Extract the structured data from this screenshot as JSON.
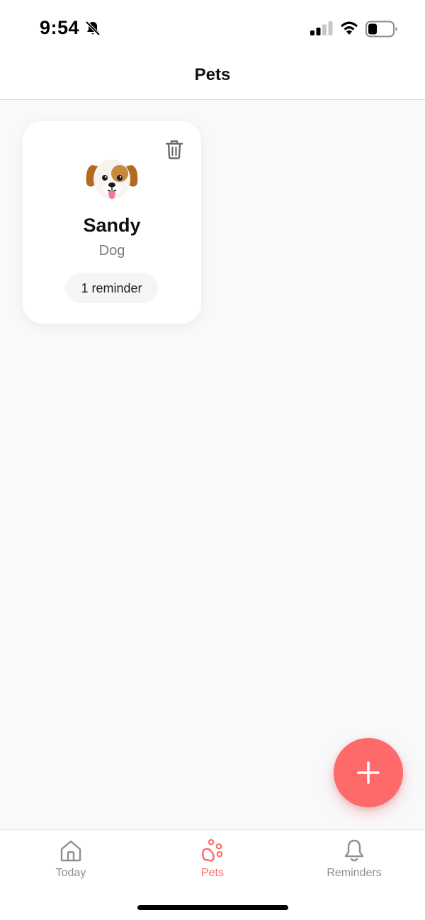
{
  "status_bar": {
    "time": "9:54",
    "icons": [
      "bell-off-icon",
      "signal-icon",
      "wifi-icon",
      "battery-icon"
    ]
  },
  "header": {
    "title": "Pets"
  },
  "pets": [
    {
      "name": "Sandy",
      "type": "Dog",
      "avatar": "dog-face-icon",
      "reminders": "1 reminder",
      "delete_icon": "trash-icon"
    }
  ],
  "fab": {
    "icon": "plus-icon",
    "color": "#fe6a6a"
  },
  "tabs": [
    {
      "label": "Today",
      "icon": "home-icon",
      "active": false
    },
    {
      "label": "Pets",
      "icon": "paw-icon",
      "active": true
    },
    {
      "label": "Reminders",
      "icon": "bell-icon",
      "active": false
    }
  ],
  "colors": {
    "accent": "#fe6a6a",
    "background": "#f8f9fb",
    "inactive": "#8e8e93"
  }
}
